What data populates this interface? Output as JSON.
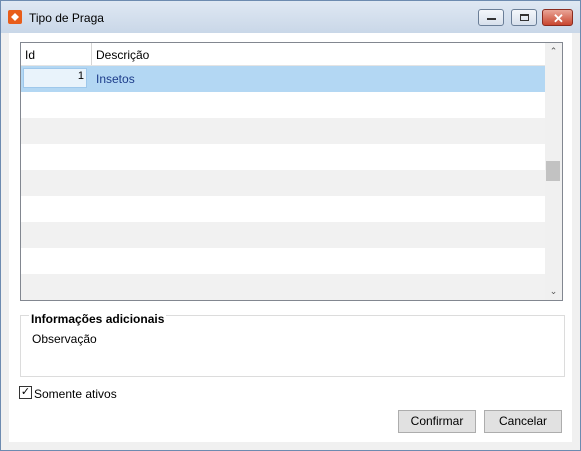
{
  "window": {
    "title": "Tipo de Praga"
  },
  "grid": {
    "columns": [
      "Id",
      "Descrição"
    ],
    "rows": [
      {
        "id": "1",
        "descricao": "Insetos"
      }
    ]
  },
  "info": {
    "title": "Informações adicionais",
    "observacao_label": "Observação"
  },
  "filter": {
    "somente_ativos_label": "Somente ativos",
    "checked": true
  },
  "actions": {
    "confirm_label": "Confirmar",
    "cancel_label": "Cancelar"
  },
  "colors": {
    "selection": "#b3d7f3",
    "row_alt": "#f1f1f1",
    "close_button": "#c9462f"
  }
}
